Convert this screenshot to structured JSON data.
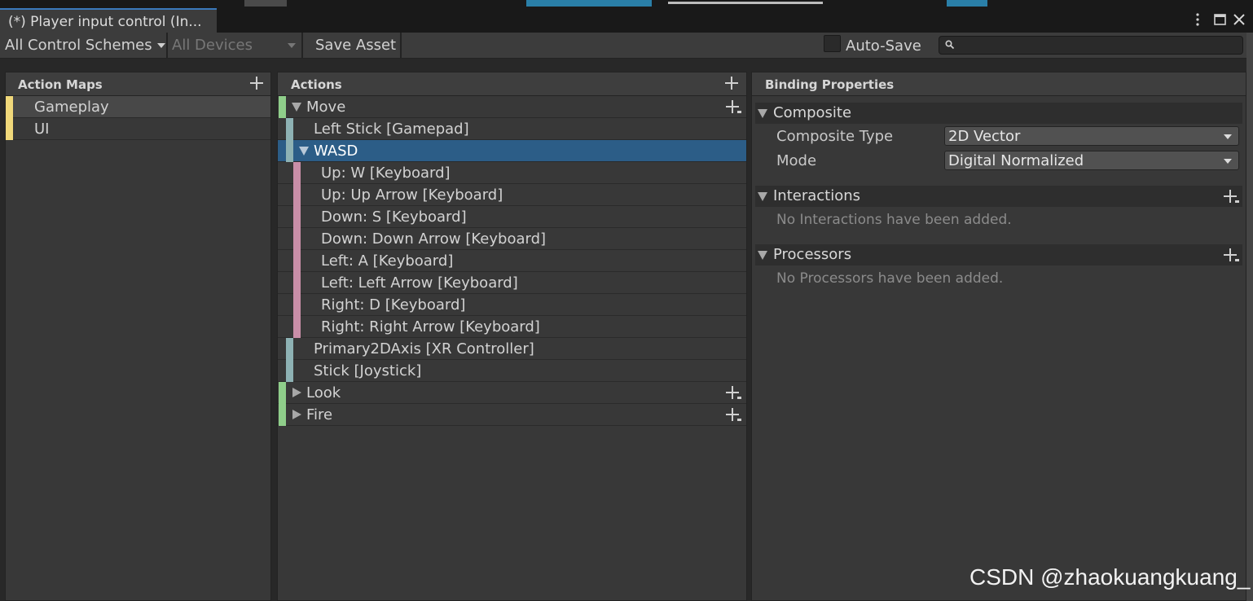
{
  "window": {
    "tab_title": "(*) Player input control (In...",
    "controls": [
      "more-options-icon",
      "maximize-icon",
      "close-icon"
    ]
  },
  "toolbar": {
    "control_schemes": "All Control Schemes",
    "devices": "All Devices",
    "save_asset": "Save Asset",
    "auto_save_label": "Auto-Save",
    "auto_save_checked": false,
    "search_value": "",
    "search_icon": "search-icon"
  },
  "action_maps": {
    "title": "Action Maps",
    "items": [
      {
        "label": "Gameplay",
        "selected": true
      },
      {
        "label": "UI",
        "selected": false
      }
    ]
  },
  "actions": {
    "title": "Actions",
    "rows": [
      {
        "label": "Move",
        "kind": "action",
        "expanded": true
      },
      {
        "label": "Left Stick [Gamepad]",
        "kind": "binding"
      },
      {
        "label": "WASD",
        "kind": "composite",
        "expanded": true,
        "selected": true
      },
      {
        "label": "Up: W [Keyboard]",
        "kind": "part"
      },
      {
        "label": "Up: Up Arrow [Keyboard]",
        "kind": "part"
      },
      {
        "label": "Down: S [Keyboard]",
        "kind": "part"
      },
      {
        "label": "Down: Down Arrow [Keyboard]",
        "kind": "part"
      },
      {
        "label": "Left: A [Keyboard]",
        "kind": "part"
      },
      {
        "label": "Left: Left Arrow [Keyboard]",
        "kind": "part"
      },
      {
        "label": "Right: D [Keyboard]",
        "kind": "part"
      },
      {
        "label": "Right: Right Arrow [Keyboard]",
        "kind": "part"
      },
      {
        "label": "Primary2DAxis [XR Controller]",
        "kind": "binding"
      },
      {
        "label": "Stick [Joystick]",
        "kind": "binding"
      },
      {
        "label": "Look",
        "kind": "action",
        "expanded": false
      },
      {
        "label": "Fire",
        "kind": "action",
        "expanded": false
      }
    ]
  },
  "binding_properties": {
    "title": "Binding Properties",
    "composite": {
      "title": "Composite",
      "composite_type_label": "Composite Type",
      "composite_type_value": "2D Vector",
      "mode_label": "Mode",
      "mode_value": "Digital Normalized"
    },
    "interactions": {
      "title": "Interactions",
      "empty": "No Interactions have been added."
    },
    "processors": {
      "title": "Processors",
      "empty": "No Processors have been added."
    }
  },
  "watermark": "CSDN @zhaokuangkuang_",
  "colors": {
    "action_map_stripe": "#f0d87a",
    "action_stripe": "#8fce8a",
    "binding_stripe": "#8eb2b4",
    "part_stripe": "#c98ea8",
    "selection": "#2c5d87",
    "tab_accent": "#3a79bb"
  }
}
